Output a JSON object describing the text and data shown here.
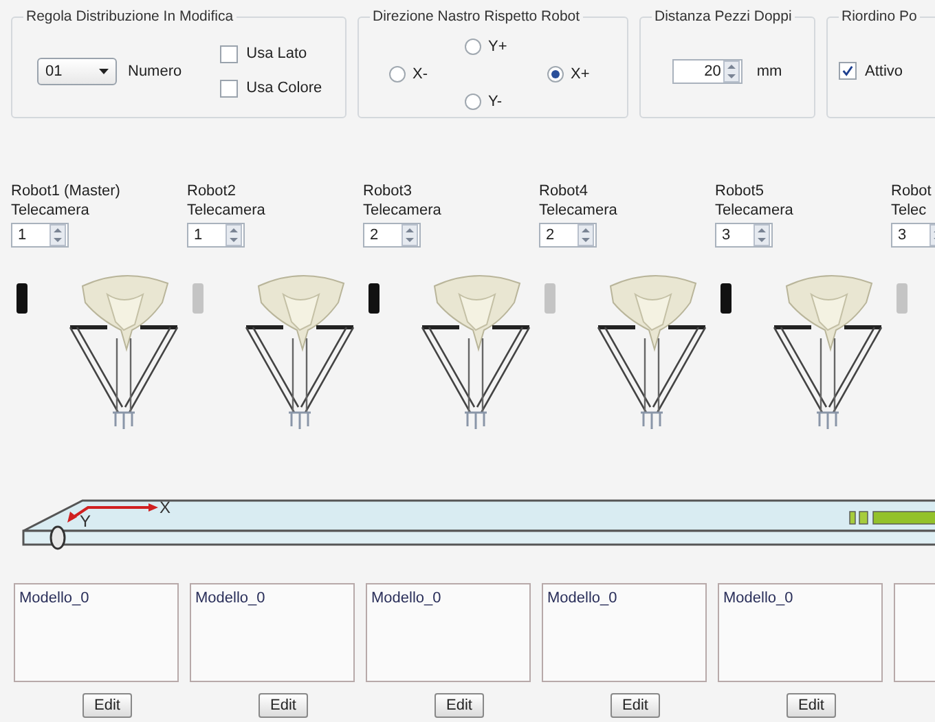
{
  "rule_group": {
    "title": "Regola Distribuzione In Modifica",
    "number_select": {
      "value": "01"
    },
    "number_label": "Numero",
    "checkboxes": [
      {
        "label": "Usa Lato",
        "checked": false
      },
      {
        "label": "Usa Colore",
        "checked": false
      }
    ]
  },
  "direction_group": {
    "title": "Direzione Nastro Rispetto Robot",
    "radios": [
      {
        "label": "X-",
        "selected": false
      },
      {
        "label": "Y+",
        "selected": false
      },
      {
        "label": "Y-",
        "selected": false
      },
      {
        "label": "X+",
        "selected": true
      }
    ]
  },
  "distance_group": {
    "title": "Distanza Pezzi Doppi",
    "spin": {
      "value": "20"
    },
    "unit": "mm"
  },
  "reorder_group": {
    "title": "Riordino Po",
    "checkbox": {
      "label": "Attivo",
      "checked": true
    }
  },
  "robots": [
    {
      "name": "Robot1 (Master)",
      "camera_label": "Telecamera",
      "camera_number": "1",
      "camera_active": true,
      "model": "Modello_0",
      "edit_button": "Edit"
    },
    {
      "name": "Robot2",
      "camera_label": "Telecamera",
      "camera_number": "1",
      "camera_active": false,
      "model": "Modello_0",
      "edit_button": "Edit"
    },
    {
      "name": "Robot3",
      "camera_label": "Telecamera",
      "camera_number": "2",
      "camera_active": true,
      "model": "Modello_0",
      "edit_button": "Edit"
    },
    {
      "name": "Robot4",
      "camera_label": "Telecamera",
      "camera_number": "2",
      "camera_active": false,
      "model": "Modello_0",
      "edit_button": "Edit"
    },
    {
      "name": "Robot5",
      "camera_label": "Telecamera",
      "camera_number": "3",
      "camera_active": true,
      "model": "Modello_0",
      "edit_button": "Edit"
    },
    {
      "name": "Robot",
      "camera_label": "Telec",
      "camera_number": "3",
      "camera_active": false
    }
  ],
  "conveyor": {
    "axis_x": "X",
    "axis_y": "Y"
  }
}
